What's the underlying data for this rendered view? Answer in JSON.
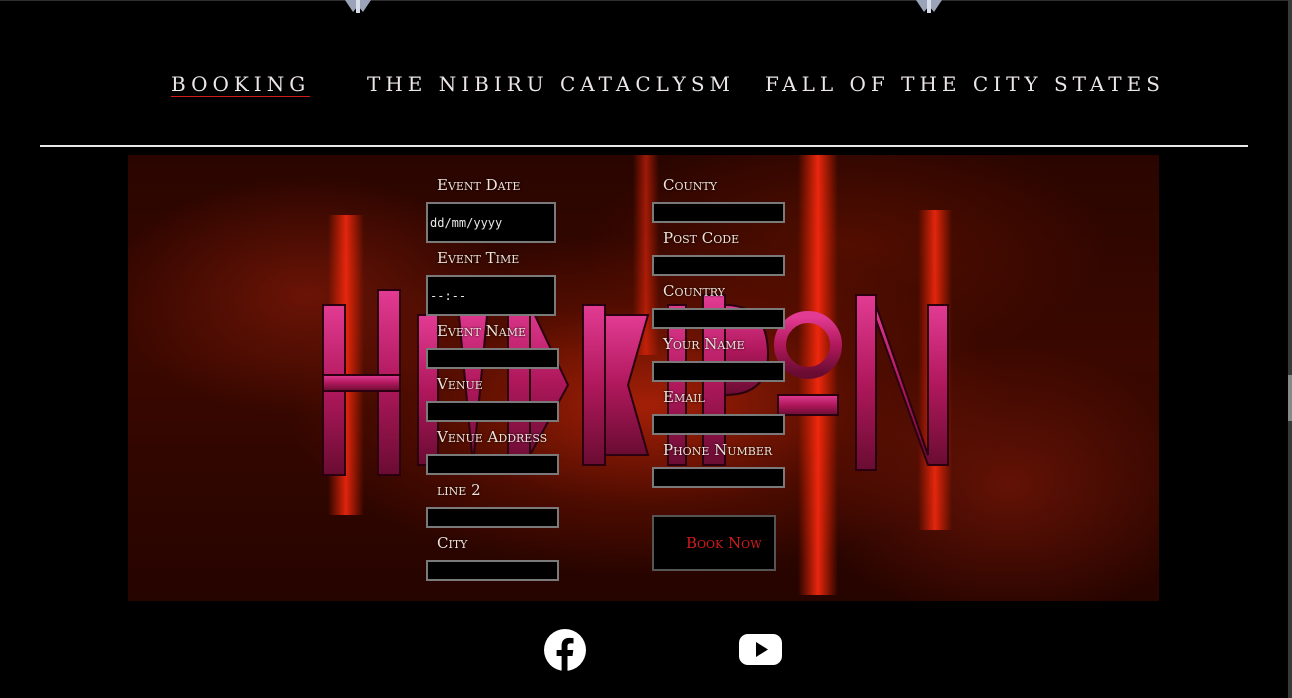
{
  "nav": {
    "items": [
      {
        "label": "BOOKING",
        "active": true
      },
      {
        "label": "THE NIBIRU CATACLYSM",
        "active": false
      },
      {
        "label": "FALL OF THE CITY STATES",
        "active": false
      }
    ]
  },
  "form": {
    "event_date": {
      "label": "Event Date",
      "placeholder": "dd/mm/yyyy"
    },
    "event_time": {
      "label": "Event Time",
      "placeholder": "--:--"
    },
    "event_name": {
      "label": "Event Name",
      "value": ""
    },
    "venue": {
      "label": "Venue",
      "value": ""
    },
    "venue_address": {
      "label": "Venue Address",
      "value": ""
    },
    "line2": {
      "label": "line 2",
      "value": ""
    },
    "city": {
      "label": "City",
      "value": ""
    },
    "county": {
      "label": "County",
      "value": ""
    },
    "post_code": {
      "label": "Post Code",
      "value": ""
    },
    "country": {
      "label": "Country",
      "value": ""
    },
    "your_name": {
      "label": "Your Name",
      "value": ""
    },
    "email": {
      "label": "Email",
      "value": ""
    },
    "phone_number": {
      "label": "Phone Number",
      "value": ""
    },
    "submit_label": "Book Now"
  },
  "banner": {
    "logo_icon": "band-logo-icon"
  },
  "social": [
    {
      "name": "facebook-icon"
    },
    {
      "name": "youtube-icon"
    }
  ],
  "colors": {
    "background": "#000000",
    "accent_red": "#d51a1a",
    "nav_text": "#ece6e6",
    "logo_pink": "#c81e6e"
  }
}
